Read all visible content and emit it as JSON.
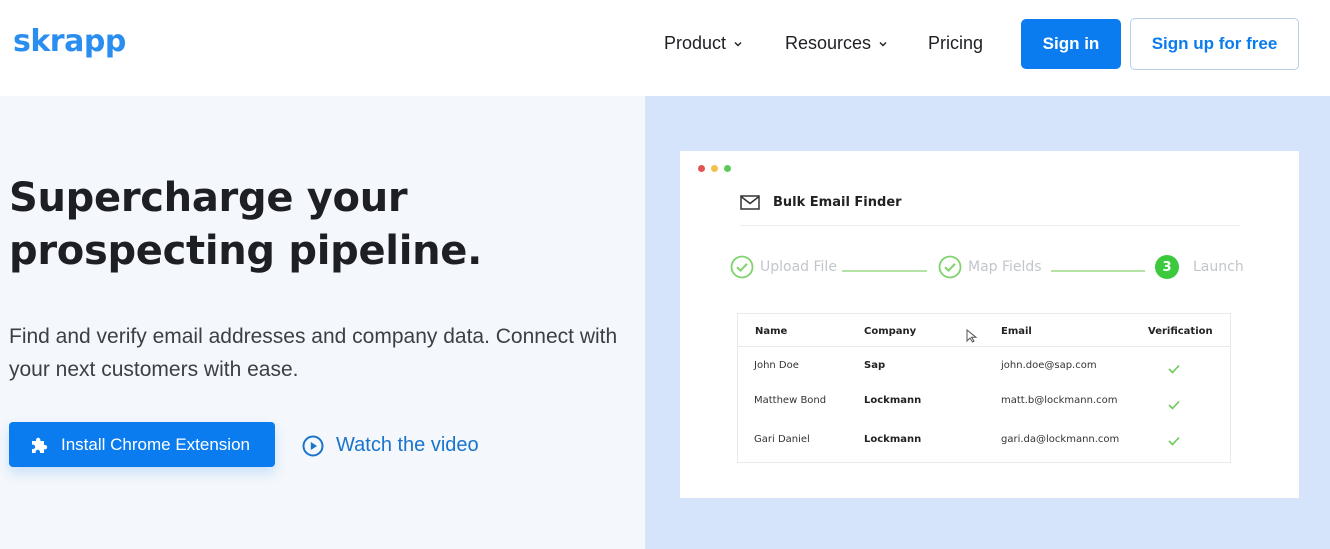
{
  "header": {
    "logo": "skrapp",
    "nav": [
      {
        "label": "Product",
        "has_dropdown": true
      },
      {
        "label": "Resources",
        "has_dropdown": true
      },
      {
        "label": "Pricing",
        "has_dropdown": false
      }
    ],
    "sign_in_label": "Sign in",
    "sign_up_label": "Sign up for free"
  },
  "hero": {
    "title": "Supercharge your prospecting pipeline.",
    "subtitle": "Find and verify email addresses and company data. Connect with your next customers with ease.",
    "install_button_label": "Install Chrome Extension",
    "watch_video_label": "Watch the video"
  },
  "preview": {
    "window_dots": [
      "#e55454",
      "#f5c04a",
      "#5cc95a"
    ],
    "card_title": "Bulk Email Finder",
    "steps": [
      {
        "label": "Upload File",
        "status": "done"
      },
      {
        "label": "Map Fields",
        "status": "done"
      },
      {
        "label": "Launch",
        "status": "active",
        "number": "3"
      }
    ],
    "table": {
      "columns": [
        "Name",
        "Company",
        "Email",
        "Verification"
      ],
      "rows": [
        {
          "name": "John Doe",
          "company": "Sap",
          "email": "john.doe@sap.com",
          "verified": true
        },
        {
          "name": "Matthew Bond",
          "company": "Lockmann",
          "email": "matt.b@lockmann.com",
          "verified": true
        },
        {
          "name": "Gari Daniel",
          "company": "Lockmann",
          "email": "gari.da@lockmann.com",
          "verified": true
        }
      ]
    }
  },
  "colors": {
    "brand_blue": "#0a7cef",
    "logo_blue": "#2a8df0",
    "hero_left_bg": "#f4f7fb",
    "hero_right_bg": "#d6e4fb",
    "success_green": "#3dc93d"
  }
}
